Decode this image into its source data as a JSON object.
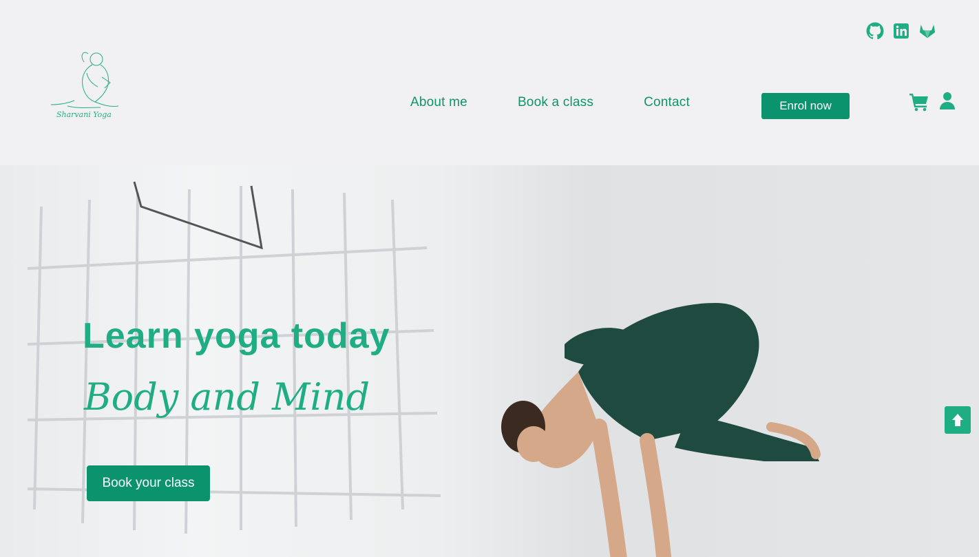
{
  "brand": {
    "logo_text": "Sharvani Yoga",
    "accent_color": "#0a936d",
    "title_color": "#1fae84"
  },
  "social": [
    {
      "icon": "github-icon"
    },
    {
      "icon": "linkedin-icon"
    },
    {
      "icon": "gitlab-icon"
    }
  ],
  "nav": {
    "items": [
      {
        "label": "About me"
      },
      {
        "label": "Book a class"
      },
      {
        "label": "Contact"
      }
    ],
    "enrol_label": "Enrol now"
  },
  "hero": {
    "title": "Learn yoga today",
    "subtitle": "Body and Mind",
    "cta_label": "Book your class"
  },
  "icons": {
    "cart": "cart-icon",
    "user": "user-icon",
    "scroll_top": "arrow-up-icon"
  }
}
